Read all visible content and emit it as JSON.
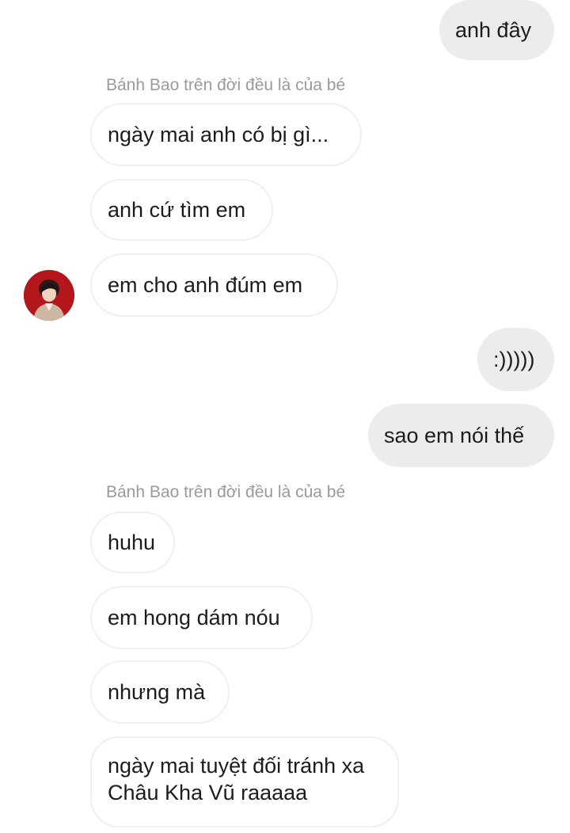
{
  "conversation": {
    "messages": [
      {
        "direction": "outgoing",
        "text": "anh đây"
      },
      {
        "direction": "sender",
        "text": "Bánh Bao trên đời đều là của bé"
      },
      {
        "direction": "incoming",
        "text": "ngày mai anh có bị gì..."
      },
      {
        "direction": "incoming",
        "text": "anh cứ tìm em"
      },
      {
        "direction": "incoming",
        "text": "em cho anh đúm em"
      },
      {
        "direction": "outgoing",
        "text": ":)))))"
      },
      {
        "direction": "outgoing",
        "text": "sao em nói thế"
      },
      {
        "direction": "sender",
        "text": "Bánh Bao trên đời đều là của bé"
      },
      {
        "direction": "incoming",
        "text": "huhu"
      },
      {
        "direction": "incoming",
        "text": "em hong dám nóu"
      },
      {
        "direction": "incoming",
        "text": "nhưng mà"
      },
      {
        "direction": "incoming",
        "text": "ngày mai tuyệt đối tránh xa Châu Kha Vũ raaaaa"
      }
    ]
  },
  "colors": {
    "outgoing_bubble": "#ececec",
    "incoming_border": "#efefef",
    "sender_text": "#9a9a9a",
    "avatar_bg": "#b3161b"
  }
}
